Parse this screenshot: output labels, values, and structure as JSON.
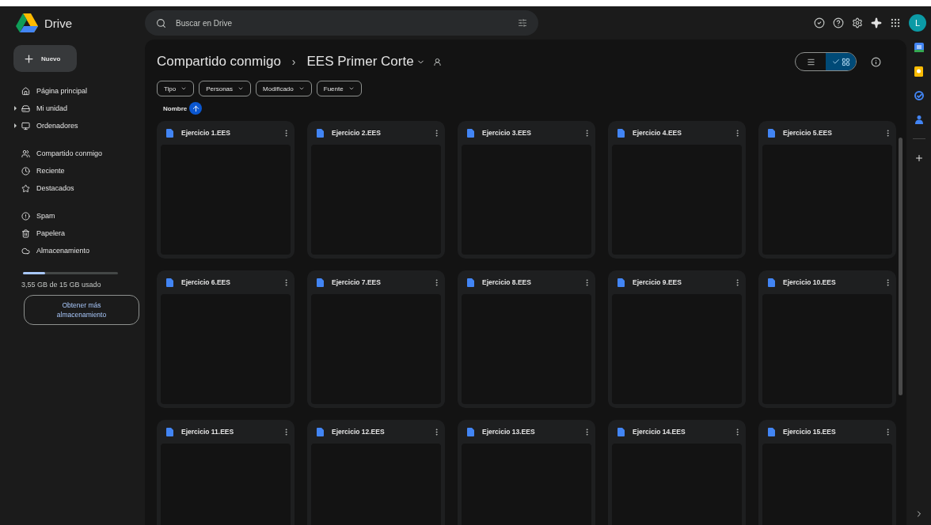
{
  "app": {
    "name": "Drive"
  },
  "search": {
    "placeholder": "Buscar en Drive"
  },
  "account": {
    "initial": "L"
  },
  "new_button": {
    "label": "Nuevo"
  },
  "sidebar": {
    "groups": [
      [
        {
          "label": "Página principal",
          "expandable": false,
          "selected": false
        },
        {
          "label": "Mi unidad",
          "expandable": true,
          "selected": false
        },
        {
          "label": "Ordenadores",
          "expandable": true,
          "selected": false
        }
      ],
      [
        {
          "label": "Compartido conmigo",
          "expandable": false,
          "selected": false
        },
        {
          "label": "Reciente",
          "expandable": false,
          "selected": false
        },
        {
          "label": "Destacados",
          "expandable": false,
          "selected": false
        }
      ],
      [
        {
          "label": "Spam",
          "expandable": false,
          "selected": false
        },
        {
          "label": "Papelera",
          "expandable": false,
          "selected": false
        },
        {
          "label": "Almacenamiento",
          "expandable": false,
          "selected": false
        }
      ]
    ]
  },
  "storage": {
    "level": 0.237,
    "usage": "3,55 GB de 15 GB usado",
    "button": "Obtener más almacenamiento"
  },
  "breadcrumb": {
    "parent": "Compartido conmigo",
    "separator": "›",
    "current": "EES Primer Corte"
  },
  "view_toggle": [
    {
      "kind": "list",
      "selected": false
    },
    {
      "kind": "grid",
      "selected": true
    }
  ],
  "filters": [
    "Tipo",
    "Personas",
    "Modificado",
    "Fuente"
  ],
  "sort": {
    "label": "Nombre"
  },
  "files": [
    {
      "name": "Ejercicio 1.EES"
    },
    {
      "name": "Ejercicio 2.EES"
    },
    {
      "name": "Ejercicio 3.EES"
    },
    {
      "name": "Ejercicio 4.EES"
    },
    {
      "name": "Ejercicio 5.EES"
    },
    {
      "name": "Ejercicio 6.EES"
    },
    {
      "name": "Ejercicio 7.EES"
    },
    {
      "name": "Ejercicio 8.EES"
    },
    {
      "name": "Ejercicio 9.EES"
    },
    {
      "name": "Ejercicio 10.EES"
    },
    {
      "name": "Ejercicio 11.EES"
    },
    {
      "name": "Ejercicio 12.EES"
    },
    {
      "name": "Ejercicio 13.EES"
    },
    {
      "name": "Ejercicio 14.EES"
    },
    {
      "name": "Ejercicio 15.EES"
    }
  ]
}
